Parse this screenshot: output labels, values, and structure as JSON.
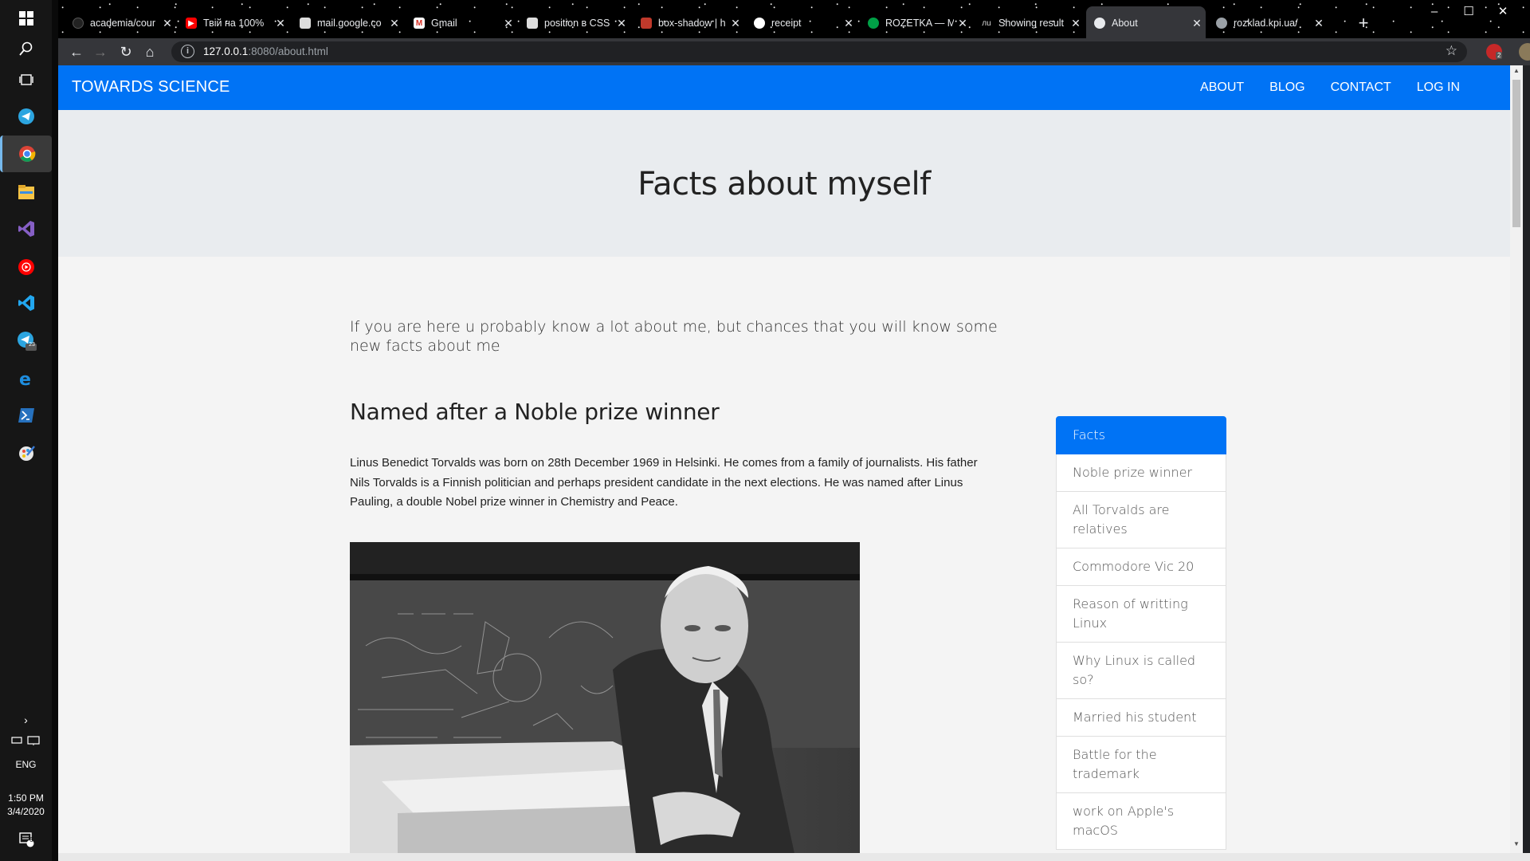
{
  "taskbar": {
    "language": "ENG",
    "time": "1:50 PM",
    "date": "3/4/2020",
    "notification_count": "6",
    "telegram_badge": "23"
  },
  "browser": {
    "tabs": [
      {
        "title": "academia/cour",
        "favicon": "github-icon",
        "color": "#222222"
      },
      {
        "title": "Твій на 100%",
        "favicon": "youtube-icon",
        "color": "#ff0000"
      },
      {
        "title": "mail.google.co",
        "favicon": "mail-icon",
        "color": "#dddddd"
      },
      {
        "title": "Gmail",
        "favicon": "gmail-icon",
        "color": "#d93025"
      },
      {
        "title": "position в CSS",
        "favicon": "doc-icon",
        "color": "#dddddd"
      },
      {
        "title": "box-shadow | h",
        "favicon": "htmlbook-icon",
        "color": "#c0392b"
      },
      {
        "title": "receipt",
        "favicon": "receipt-icon",
        "color": "#ffffff"
      },
      {
        "title": "ROZETKA — M",
        "favicon": "rozetka-icon",
        "color": "#00a046"
      },
      {
        "title": "Showing result",
        "favicon": "search-result-icon",
        "color": "#444444"
      },
      {
        "title": "About",
        "favicon": "globe-icon",
        "color": "#e8eaed"
      },
      {
        "title": "rozklad.kpi.ua/",
        "favicon": "globe-icon",
        "color": "#9aa0a6"
      }
    ],
    "active_tab_index": 9,
    "url_host": "127.0.0.1",
    "url_rest": ":8080/about.html",
    "extension_badge": "2"
  },
  "page": {
    "brand": "TOWARDS SCIENCE",
    "nav": [
      "ABOUT",
      "BLOG",
      "CONTACT",
      "LOG IN"
    ],
    "hero_title": "Facts about myself",
    "lead": "If you are here u probably know a lot about me, but chances that you will know some new facts about me",
    "section_title": "Named after a Noble prize winner",
    "paragraph": "Linus Benedict Torvalds was born on 28th December 1969 in Helsinki. He comes from a family of journalists. His father Nils Torvalds is a Finnish politician and perhaps president candidate in the next elections. He was named after Linus Pauling, a double Nobel prize winner in Chemistry and Peace.",
    "sidebar": [
      "Facts",
      "Noble prize winner",
      "All Torvalds are relatives",
      "Commodore Vic 20",
      "Reason of writting Linux",
      "Why Linux is called so?",
      "Married his student",
      "Battle for the trademark",
      "work on Apple's macOS"
    ],
    "colors": {
      "primary": "#0073f5",
      "hero_bg": "#e9ecef",
      "page_bg": "#f4f4f4"
    }
  }
}
